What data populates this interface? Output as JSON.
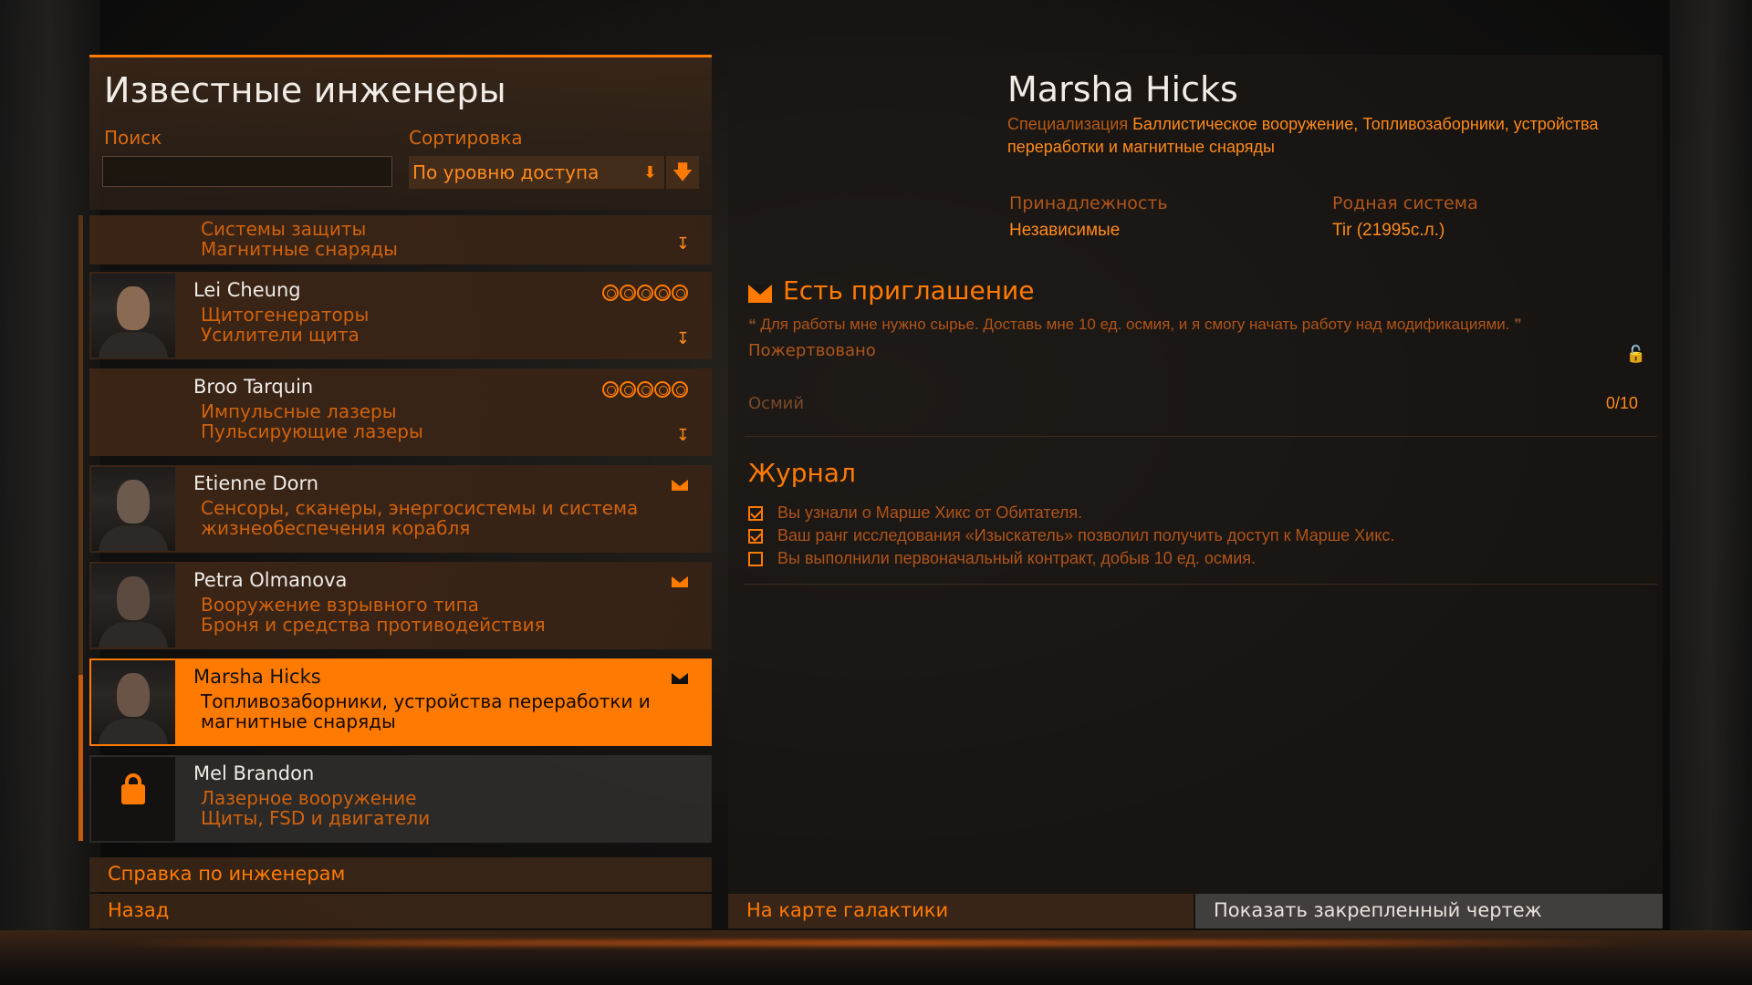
{
  "left": {
    "title": "Известные инженеры",
    "search_label": "Поиск",
    "search_placeholder": "",
    "sort_label": "Сортировка",
    "sort_value": "По уровню доступа"
  },
  "engineers": [
    {
      "name": "",
      "subs": [
        "Системы защиты",
        "Магнитные снаряды"
      ],
      "badge": "pin",
      "rank": 0,
      "state": "normal"
    },
    {
      "name": "Lei Cheung",
      "subs": [
        "Щитогенераторы",
        "Усилители щита"
      ],
      "badge": "pin",
      "rank": 5,
      "state": "normal"
    },
    {
      "name": "Broo Tarquin",
      "subs": [
        "Импульсные лазеры",
        "Пульсирующие лазеры"
      ],
      "badge": "pin",
      "rank": 5,
      "state": "normal"
    },
    {
      "name": "Etienne Dorn",
      "subs": [
        "Сенсоры, сканеры, энергосистемы и система",
        "жизнеобеспечения корабля"
      ],
      "badge": "mail",
      "rank": 0,
      "state": "normal"
    },
    {
      "name": "Petra Olmanova",
      "subs": [
        "Вооружение взрывного типа",
        "Броня и средства противодействия"
      ],
      "badge": "mail",
      "rank": 0,
      "state": "normal"
    },
    {
      "name": "Marsha Hicks",
      "subs": [
        "Топливозаборники, устройства переработки и",
        "магнитные снаряды"
      ],
      "badge": "mail",
      "rank": 0,
      "state": "active"
    },
    {
      "name": "Mel Brandon",
      "subs": [
        "Лазерное вооружение",
        "Щиты, FSD и двигатели"
      ],
      "badge": "",
      "rank": 0,
      "state": "locked"
    }
  ],
  "bottom": {
    "help": "Справка по инженерам",
    "back": "Назад"
  },
  "detail": {
    "name": "Marsha Hicks",
    "spec_label": "Специализация",
    "spec_value": "Баллистическое вооружение, Топливозаборники, устройства переработки и магнитные снаряды",
    "affiliation_label": "Принадлежность",
    "affiliation_value": "Независимые",
    "home_label": "Родная система",
    "home_value": "Tir (21995с.л.)",
    "invite_title": "Есть приглашение",
    "invite_quote": "Для работы мне нужно сырье. Доставь мне 10 ед. осмия, и я смогу начать работу над модификациями.",
    "donated_label": "Пожертвовано",
    "material_name": "Осмий",
    "material_progress": "0/10",
    "journal_title": "Журнал",
    "journal": [
      {
        "text": "Вы узнали о Марше Хикс от Обитателя.",
        "checked": true
      },
      {
        "text": "Ваш ранг исследования «Изыскатель» позволил получить доступ к Марше Хикс.",
        "checked": true
      },
      {
        "text": "Вы выполнили первоначальный контракт, добыв 10 ед. осмия.",
        "checked": false
      }
    ],
    "galaxy_button": "На карте галактики",
    "blueprint_button": "Показать закрепленный чертеж"
  },
  "colors": {
    "accent": "#ff7a00",
    "panel": "#3e2616",
    "text_light": "#f2ece6"
  },
  "icons": [
    "mail-icon",
    "pin-icon",
    "rank-icon",
    "lock-icon",
    "checkbox-icon",
    "sort-arrow-icon"
  ]
}
